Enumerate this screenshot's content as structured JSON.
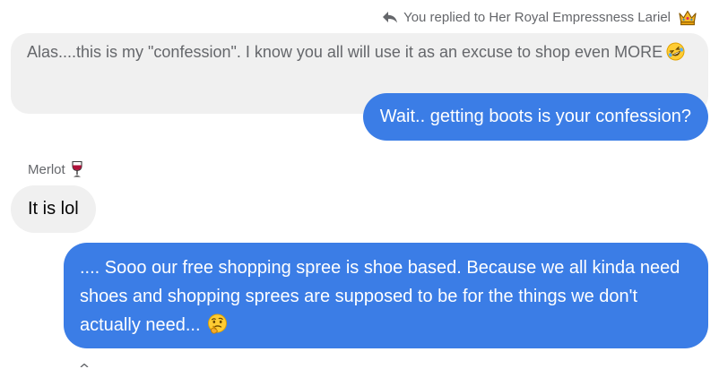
{
  "reply_indicator": {
    "text": "You replied to Her Royal Empressness Lariel",
    "icons": [
      "reply-arrow-icon",
      "crown-icon"
    ]
  },
  "messages": [
    {
      "kind": "quoted",
      "text": "Alas....this is my \"confession\". I know you all will use it as an excuse to shop even MORE",
      "emoji": "rolling-on-floor-laughing-emoji"
    },
    {
      "kind": "outgoing",
      "text": "Wait.. getting boots is your confession?"
    },
    {
      "kind": "incoming",
      "sender": "Merlot",
      "sender_icon": "wine-glass-icon",
      "text": "It is lol"
    },
    {
      "kind": "outgoing",
      "text": ".... Sooo our free shopping spree is shoe based. Because we all kinda need shoes and shopping sprees are supposed to be for the things we don't actually need...",
      "emoji": "thinking-face-emoji"
    }
  ],
  "colors": {
    "outgoing_bubble": "#3b7de6",
    "incoming_bubble": "#f0f0f0",
    "secondary_text": "#65676b",
    "primary_text": "#050505"
  }
}
